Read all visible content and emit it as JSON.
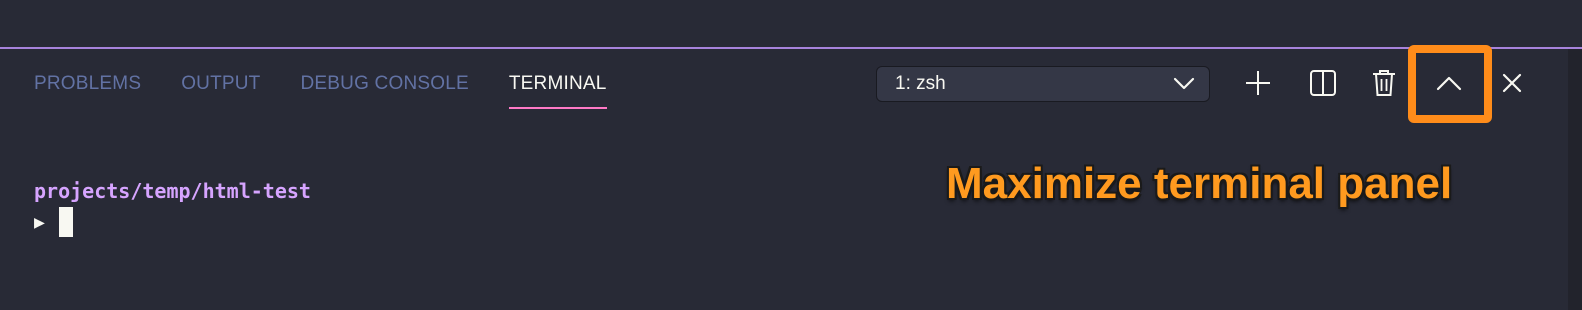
{
  "panel": {
    "tabs": [
      {
        "label": "PROBLEMS",
        "active": false
      },
      {
        "label": "OUTPUT",
        "active": false
      },
      {
        "label": "DEBUG CONSOLE",
        "active": false
      },
      {
        "label": "TERMINAL",
        "active": true
      }
    ],
    "terminal_selector": {
      "value": "1: zsh",
      "icon": "chevron-down-icon"
    },
    "actions": [
      {
        "name": "new-terminal",
        "icon": "plus-icon"
      },
      {
        "name": "split-terminal",
        "icon": "split-icon"
      },
      {
        "name": "kill-terminal",
        "icon": "trash-icon"
      },
      {
        "name": "maximize-panel",
        "icon": "chevron-up-icon",
        "highlighted": true
      },
      {
        "name": "close-panel",
        "icon": "close-icon"
      }
    ]
  },
  "terminal": {
    "path": "projects/temp/html-test",
    "prompt_symbol": "▶"
  },
  "annotation": {
    "text": "Maximize terminal panel",
    "color": "#ff9a1f"
  },
  "colors": {
    "background": "#282a36",
    "active_tab_underline": "#ff79c6",
    "inactive_tab": "#6272a4",
    "path": "#d6a4ff",
    "highlight": "#ff8c1a"
  }
}
